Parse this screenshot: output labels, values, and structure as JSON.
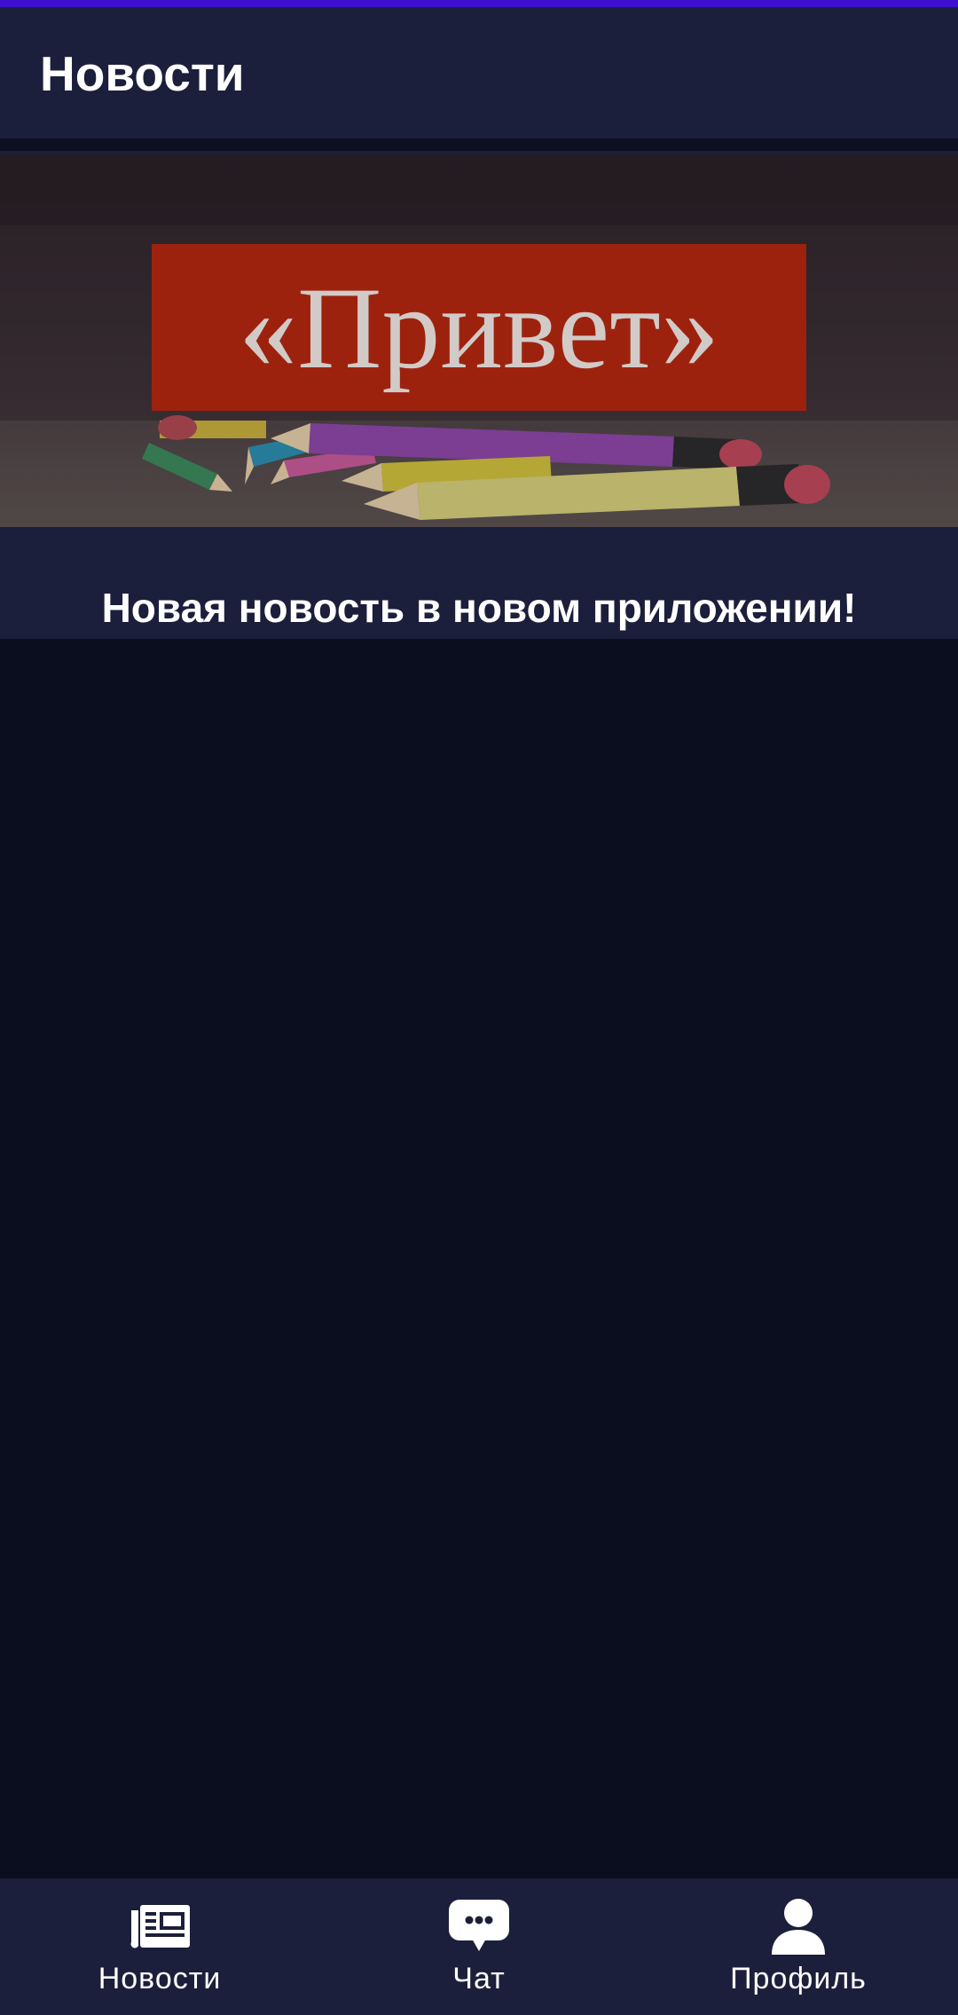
{
  "app_bar": {
    "title": "Новости"
  },
  "news": [
    {
      "image_text": "«Привет»",
      "title": "Новая новость в новом приложении!"
    }
  ],
  "bottom_nav": {
    "items": [
      {
        "label": "Новости",
        "icon": "newspaper-icon"
      },
      {
        "label": "Чат",
        "icon": "chat-bubble-icon"
      },
      {
        "label": "Профиль",
        "icon": "person-icon"
      }
    ]
  },
  "colors": {
    "background": "#0b0e1f",
    "surface": "#1c1f3b",
    "accent": "#3d0fcf",
    "banner_red": "#b5260c",
    "text": "#ffffff"
  }
}
